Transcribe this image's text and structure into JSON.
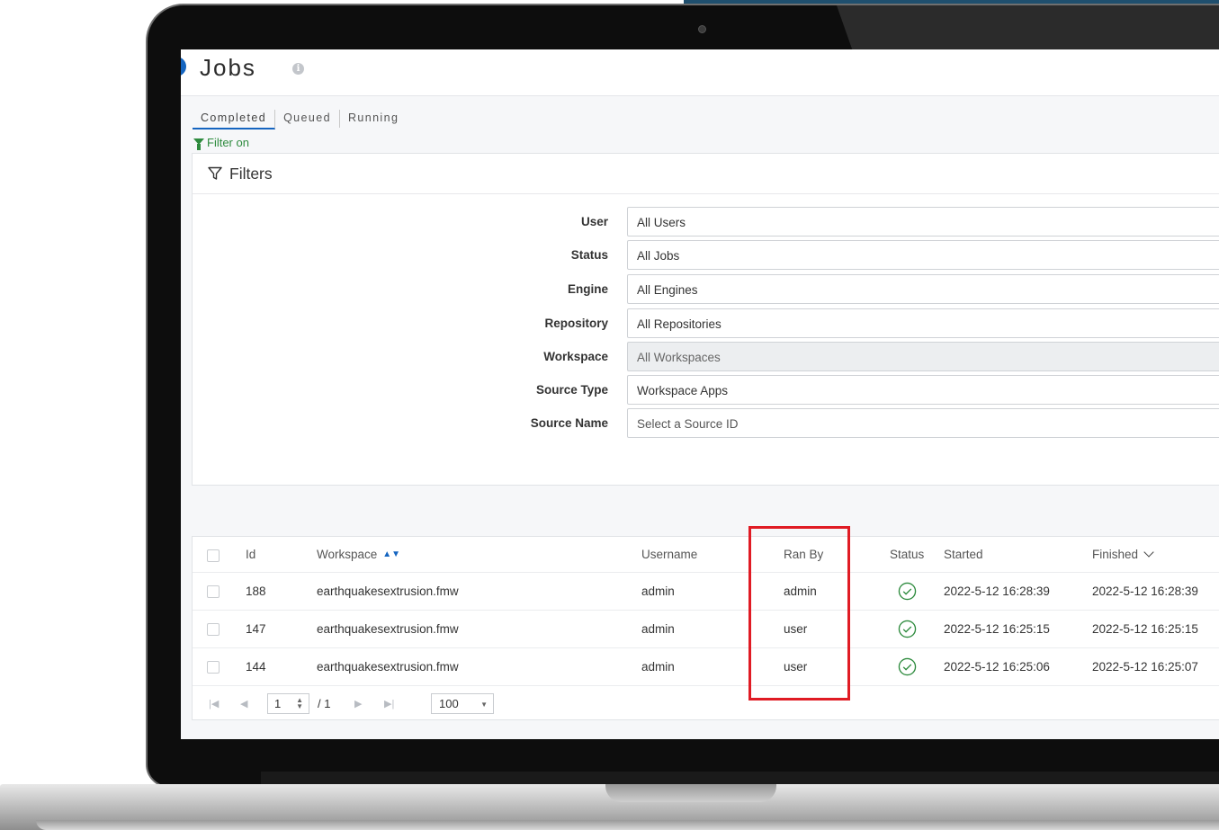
{
  "page": {
    "title": "Jobs"
  },
  "tabs": [
    {
      "label": "Completed",
      "active": true
    },
    {
      "label": "Queued",
      "active": false
    },
    {
      "label": "Running",
      "active": false
    }
  ],
  "filter_on_label": "Filter on",
  "filters": {
    "heading": "Filters",
    "rows": [
      {
        "label": "User",
        "value": "All Users",
        "disabled": false
      },
      {
        "label": "Status",
        "value": "All Jobs",
        "disabled": false
      },
      {
        "label": "Engine",
        "value": "All Engines",
        "disabled": false
      },
      {
        "label": "Repository",
        "value": "All Repositories",
        "disabled": false
      },
      {
        "label": "Workspace",
        "value": "All Workspaces",
        "disabled": true
      },
      {
        "label": "Source Type",
        "value": "Workspace Apps",
        "disabled": false
      },
      {
        "label": "Source Name",
        "placeholder": "Select a Source ID",
        "disabled": false
      }
    ]
  },
  "table": {
    "columns": {
      "id": "Id",
      "workspace": "Workspace",
      "username": "Username",
      "ran_by": "Ran By",
      "status": "Status",
      "started": "Started",
      "finished": "Finished"
    },
    "rows": [
      {
        "id": "188",
        "workspace": "earthquakesextrusion.fmw",
        "username": "admin",
        "ran_by": "admin",
        "status": "success",
        "started": "2022-5-12 16:28:39",
        "finished": "2022-5-12 16:28:39"
      },
      {
        "id": "147",
        "workspace": "earthquakesextrusion.fmw",
        "username": "admin",
        "ran_by": "user",
        "status": "success",
        "started": "2022-5-12 16:25:15",
        "finished": "2022-5-12 16:25:15"
      },
      {
        "id": "144",
        "workspace": "earthquakesextrusion.fmw",
        "username": "admin",
        "ran_by": "user",
        "status": "success",
        "started": "2022-5-12 16:25:06",
        "finished": "2022-5-12 16:25:07"
      }
    ]
  },
  "pager": {
    "first": "|◀",
    "prev": "◀",
    "next": "▶",
    "last": "▶|",
    "current_page": "1",
    "total_pages": "/ 1",
    "page_size": "100"
  },
  "colors": {
    "accent": "#1565c0",
    "success": "#2e8b3e",
    "highlight": "#e01b24"
  }
}
